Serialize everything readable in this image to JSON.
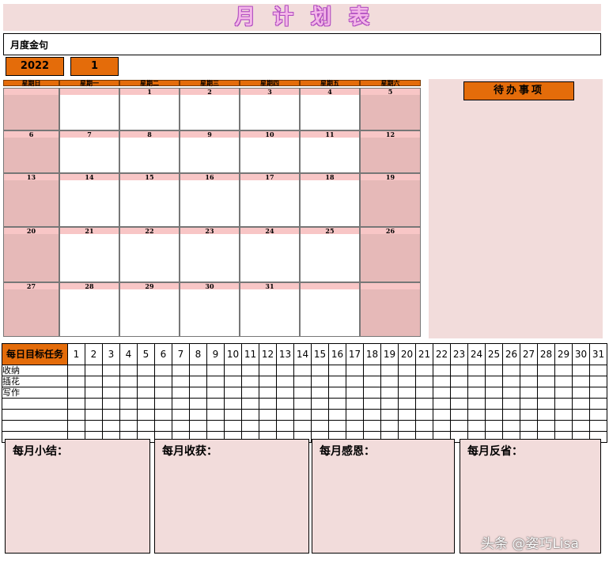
{
  "title": "月计划表",
  "motto_label": "月度金句",
  "year": "2022",
  "month": "1",
  "weekdays": [
    "星期日",
    "星期一",
    "星期二",
    "星期三",
    "星期四",
    "星期五",
    "星期六"
  ],
  "calendar_days": [
    "",
    "",
    "1",
    "2",
    "3",
    "4",
    "5",
    "6",
    "7",
    "8",
    "9",
    "10",
    "11",
    "12",
    "13",
    "14",
    "15",
    "16",
    "17",
    "18",
    "19",
    "20",
    "21",
    "22",
    "23",
    "24",
    "25",
    "26",
    "27",
    "28",
    "29",
    "30",
    "31",
    "",
    ""
  ],
  "todo_title": "待办事项",
  "goals": {
    "header": "每日目标任务",
    "days": [
      "1",
      "2",
      "3",
      "4",
      "5",
      "6",
      "7",
      "8",
      "9",
      "10",
      "11",
      "12",
      "13",
      "14",
      "15",
      "16",
      "17",
      "18",
      "19",
      "20",
      "21",
      "22",
      "23",
      "24",
      "25",
      "26",
      "27",
      "28",
      "29",
      "30",
      "31"
    ],
    "tasks": [
      "收纳",
      "插花",
      "写作",
      "",
      "",
      "",
      ""
    ]
  },
  "summaries": [
    "每月小结：",
    "每月收获：",
    "每月感恩：",
    "每月反省："
  ],
  "watermark": "头条 @姿巧Lisa",
  "colors": {
    "accent": "#e46c0a",
    "panel": "#f2dcdb",
    "weekend": "#e6b9b8",
    "day_strip": "#f8c6c6"
  }
}
